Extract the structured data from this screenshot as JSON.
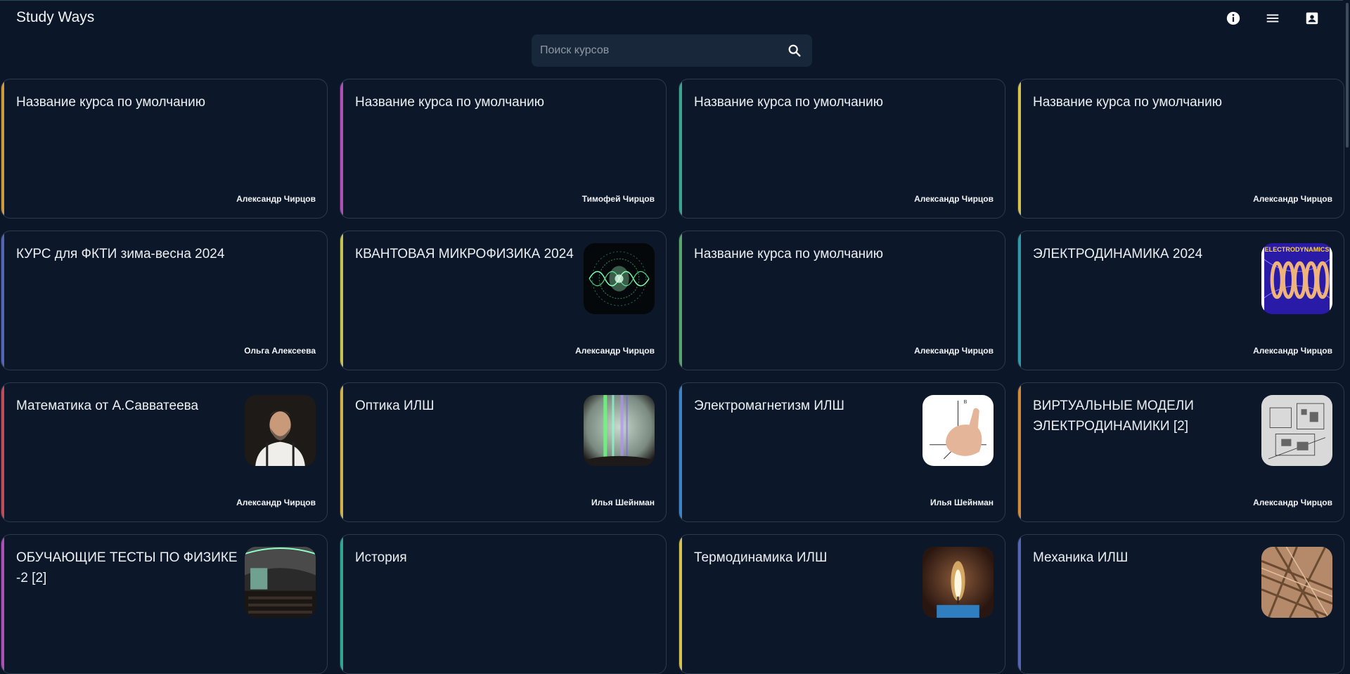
{
  "app": {
    "title": "Study Ways"
  },
  "header_icons": [
    "info-icon",
    "menu-icon",
    "account-box-icon"
  ],
  "search": {
    "placeholder": "Поиск курсов",
    "value": ""
  },
  "courses": [
    {
      "title": "Название курса по умолчанию",
      "author": "Александр Чирцов",
      "accent": "#d29a3a",
      "image": null
    },
    {
      "title": "Название курса по умолчанию",
      "author": "Тимофей Чирцов",
      "accent": "#b04fb6",
      "image": null
    },
    {
      "title": "Название курса по умолчанию",
      "author": "Александр Чирцов",
      "accent": "#3aa58f",
      "image": null
    },
    {
      "title": "Название курса по умолчанию",
      "author": "Александр Чирцов",
      "accent": "#d8c24a",
      "image": null
    },
    {
      "title": "КУРС для ФКТИ зима-весна 2024",
      "author": "Ольга Алексеева",
      "accent": "#5565b5",
      "image": null
    },
    {
      "title": "КВАНТОВАЯ МИКРОФИЗИКА 2024",
      "author": "Александр Чирцов",
      "accent": "#c7c34e",
      "image": "quantum-wave"
    },
    {
      "title": "Название курса по умолчанию",
      "author": "Александр Чирцов",
      "accent": "#5aa56a",
      "image": null
    },
    {
      "title": "ЭЛЕКТРОДИНАМИКА 2024",
      "author": "Александр Чирцов",
      "accent": "#2e9aa8",
      "image": "electrodynamics",
      "image_text": "ELECTRODYNAMICS"
    },
    {
      "title": "Математика от А.Савватеева",
      "author": "Александр Чирцов",
      "accent": "#c44a5a",
      "image": "portrait"
    },
    {
      "title": "Оптика ИЛШ",
      "author": "Илья Шейнман",
      "accent": "#d2b14a",
      "image": "spectrum"
    },
    {
      "title": "Электромагнетизм ИЛШ",
      "author": "Илья Шейнман",
      "accent": "#3c84c8",
      "image": "hand-rule"
    },
    {
      "title": "ВИРТУАЛЬНЫЕ МОДЕЛИ ЭЛЕКТРОДИНАМИКИ [2]",
      "author": "Александр Чирцов",
      "accent": "#d28a3a",
      "image": "sketch"
    },
    {
      "title": "ОБУЧАЮЩИЕ ТЕСТЫ ПО ФИЗИКЕ -2 [2]",
      "author": "",
      "accent": "#b04fb6",
      "image": "lecture-hall"
    },
    {
      "title": "История",
      "author": "",
      "accent": "#2ea890",
      "image": null
    },
    {
      "title": "Термодинамика ИЛШ",
      "author": "",
      "accent": "#d8c24a",
      "image": "candle"
    },
    {
      "title": "Механика ИЛШ",
      "author": "",
      "accent": "#5565b5",
      "image": "rods"
    }
  ]
}
